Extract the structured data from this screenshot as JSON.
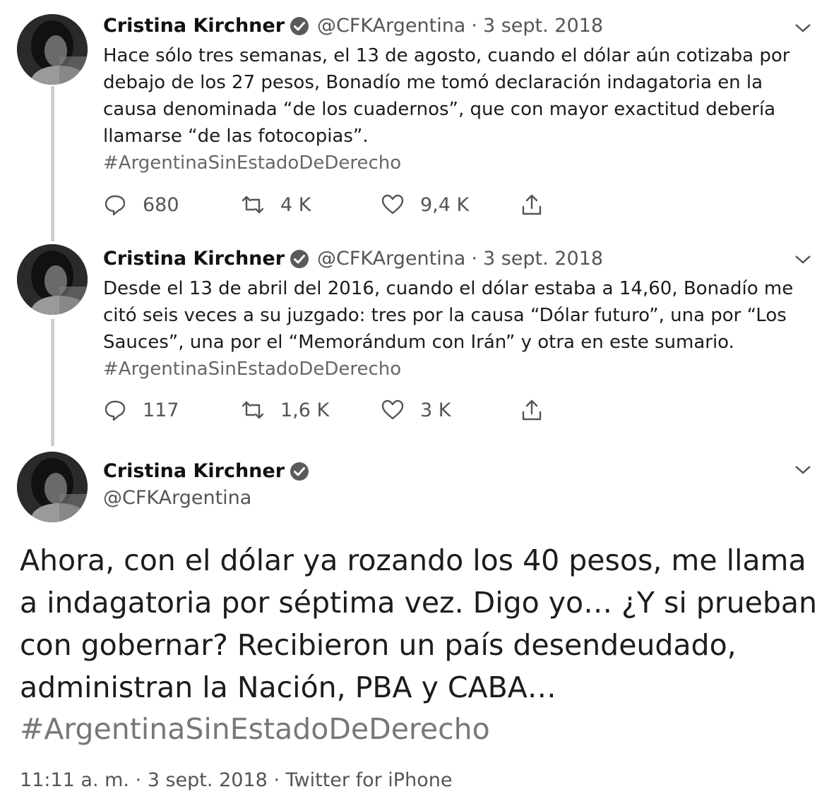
{
  "tweets": [
    {
      "name": "Cristina Kirchner",
      "handle": "@CFKArgentina",
      "separator": "·",
      "date": "3 sept. 2018",
      "text": "Hace sólo tres semanas, el 13 de agosto, cuando el dólar aún cotizaba por\ndebajo de los 27 pesos, Bonadío me tomó declaración indagatoria en la\ncausa denominada “de los cuadernos”, que con mayor exactitud debería\nllamarse “de las fotocopias”.",
      "hashtag": "#ArgentinaSinEstadoDeDerecho",
      "replies": "680",
      "retweets": "4 K",
      "likes": "9,4 K"
    },
    {
      "name": "Cristina Kirchner",
      "handle": "@CFKArgentina",
      "separator": "·",
      "date": "3 sept. 2018",
      "text": "Desde el 13 de abril del 2016, cuando el dólar estaba a 14,60, Bonadío me\ncitó seis veces a su juzgado: tres por la causa “Dólar futuro”, una por “Los\nSauces”, una por el “Memorándum con Irán” y otra en este sumario.",
      "hashtag": "#ArgentinaSinEstadoDeDerecho",
      "replies": "117",
      "retweets": "1,6 K",
      "likes": "3 K"
    }
  ],
  "main_tweet": {
    "name": "Cristina Kirchner",
    "handle": "@CFKArgentina",
    "text": "Ahora, con el dólar ya rozando los 40 pesos, me llama a indagatoria por séptima vez. Digo yo… ¿Y si prueban con gobernar? Recibieron un país desendeudado, administran la Nación, PBA y CABA…",
    "hashtag": "#ArgentinaSinEstadoDeDerecho",
    "footer": "11:11 a. m. · 3 sept. 2018 · Twitter for iPhone"
  },
  "icons": {
    "reply": "reply-icon",
    "retweet": "retweet-icon",
    "like": "heart-icon",
    "share": "share-icon",
    "verified": "verified-badge-icon",
    "menu": "chevron-down-icon"
  },
  "colors": {
    "text": "#1c1c1c",
    "muted": "#555555",
    "hashtag": "#666666",
    "thread_line": "#cfcfcf"
  }
}
